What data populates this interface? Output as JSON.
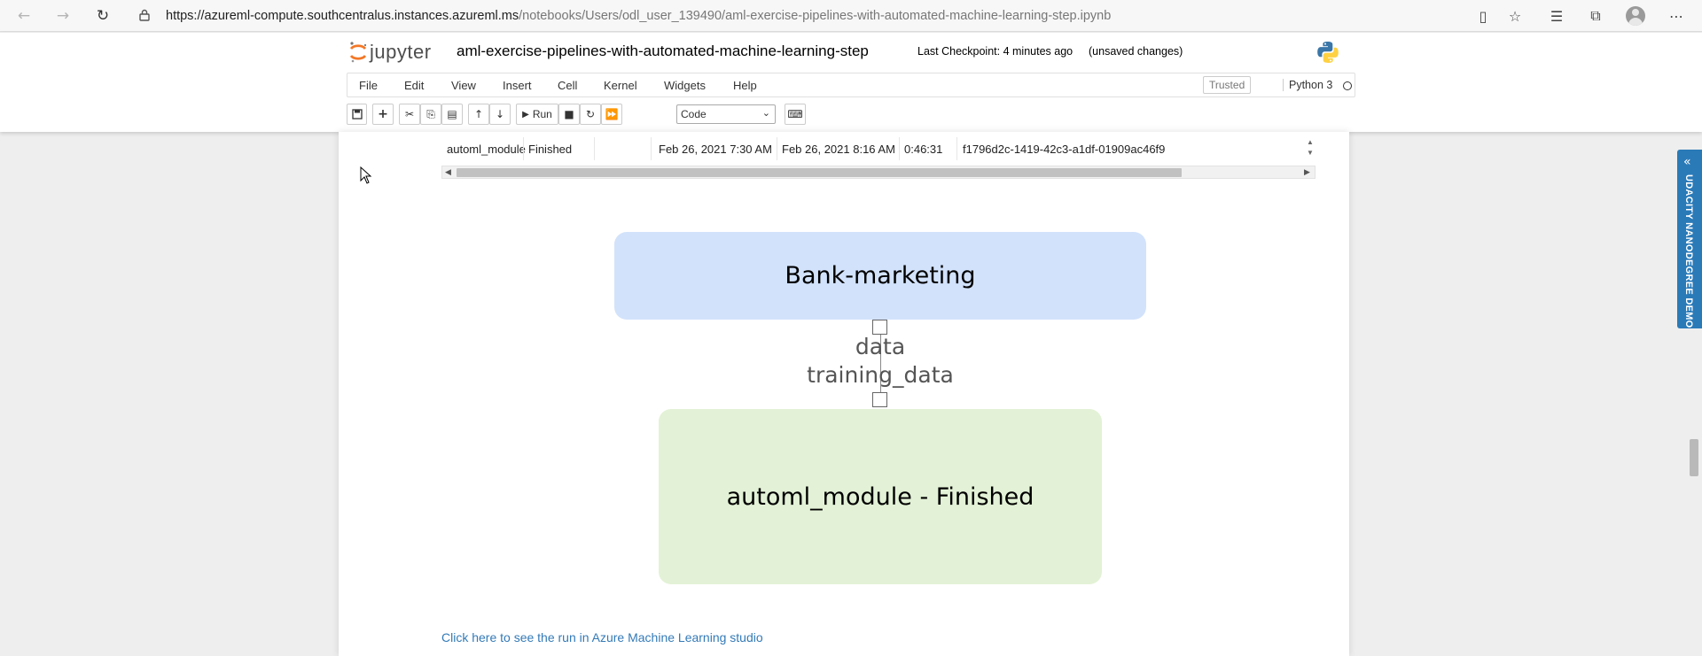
{
  "browser": {
    "url_host": "https://azureml-compute.southcentralus.instances.azureml.ms",
    "url_path": "/notebooks/Users/odl_user_139490/aml-exercise-pipelines-with-automated-machine-learning-step.ipynb"
  },
  "jupyter": {
    "logo_text": "jupyter",
    "notebook_title": "aml-exercise-pipelines-with-automated-machine-learning-step",
    "checkpoint": "Last Checkpoint: 4 minutes ago",
    "unsaved": "(unsaved changes)",
    "menu": [
      "File",
      "Edit",
      "View",
      "Insert",
      "Cell",
      "Kernel",
      "Widgets",
      "Help"
    ],
    "trusted": "Trusted",
    "kernel": "Python 3",
    "toolbar": {
      "run_label": "Run",
      "cell_type": "Code"
    }
  },
  "run_table": {
    "row": [
      "automl_module",
      "Finished",
      "",
      "Feb 26, 2021 7:30 AM",
      "Feb 26, 2021 8:16 AM",
      "0:46:31",
      "f1796d2c-1419-42c3-a1df-01909ac46f9"
    ]
  },
  "pipeline_graph": {
    "source_node": "Bank-marketing",
    "edge_label_top": "data",
    "edge_label_bottom": "training_data",
    "step_node": "automl_module - Finished"
  },
  "studio_link": "Click here to see the run in Azure Machine Learning studio",
  "side_panel": {
    "label": "UDACITY NANODEGREE DEMO"
  },
  "colors": {
    "source_node": "#d2e2fb",
    "step_node": "#e3f2d6",
    "link": "#337ab7",
    "side_panel": "#2a7ab8"
  }
}
